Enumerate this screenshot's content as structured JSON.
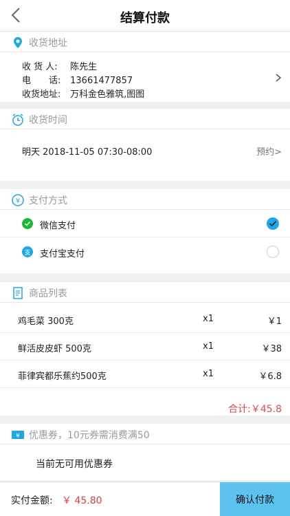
{
  "header": {
    "title": "结算付款"
  },
  "address": {
    "section_title": "收货地址",
    "receiver_label": "收 货 人:",
    "receiver": "陈先生",
    "phone_label": "电　　话:",
    "phone": "13661477857",
    "addr_label": "收货地址:",
    "addr": "万科金色雅筑,图图"
  },
  "delivery_time": {
    "section_title": "收货时间",
    "time": "明天 2018-11-05 07:30-08:00",
    "reserve": "预约>"
  },
  "payment": {
    "section_title": "支付方式",
    "options": [
      {
        "label": "微信支付",
        "selected": true
      },
      {
        "label": "支付宝支付",
        "selected": false
      }
    ]
  },
  "products": {
    "section_title": "商品列表",
    "items": [
      {
        "name": "鸡毛菜 300克",
        "qty": "x1",
        "price": "￥1"
      },
      {
        "name": "鲜活皮皮虾 500克",
        "qty": "x1",
        "price": "￥38"
      },
      {
        "name": "菲律宾都乐蕉约500克",
        "qty": "x1",
        "price": "￥6.8"
      }
    ],
    "total": "合计:￥45.8"
  },
  "coupon": {
    "section_title": "优惠券，10元券需消费满50",
    "none_text": "当前无可用优惠券"
  },
  "footer": {
    "amount_label": "实付金额:",
    "amount": "￥ 45.80",
    "confirm_label": "确认付款"
  },
  "colors": {
    "accent": "#1ea7e6",
    "button": "#5ec2f0",
    "price_red": "#e24b4b",
    "wechat_green": "#19b938",
    "alipay_blue": "#1ea7e6"
  }
}
